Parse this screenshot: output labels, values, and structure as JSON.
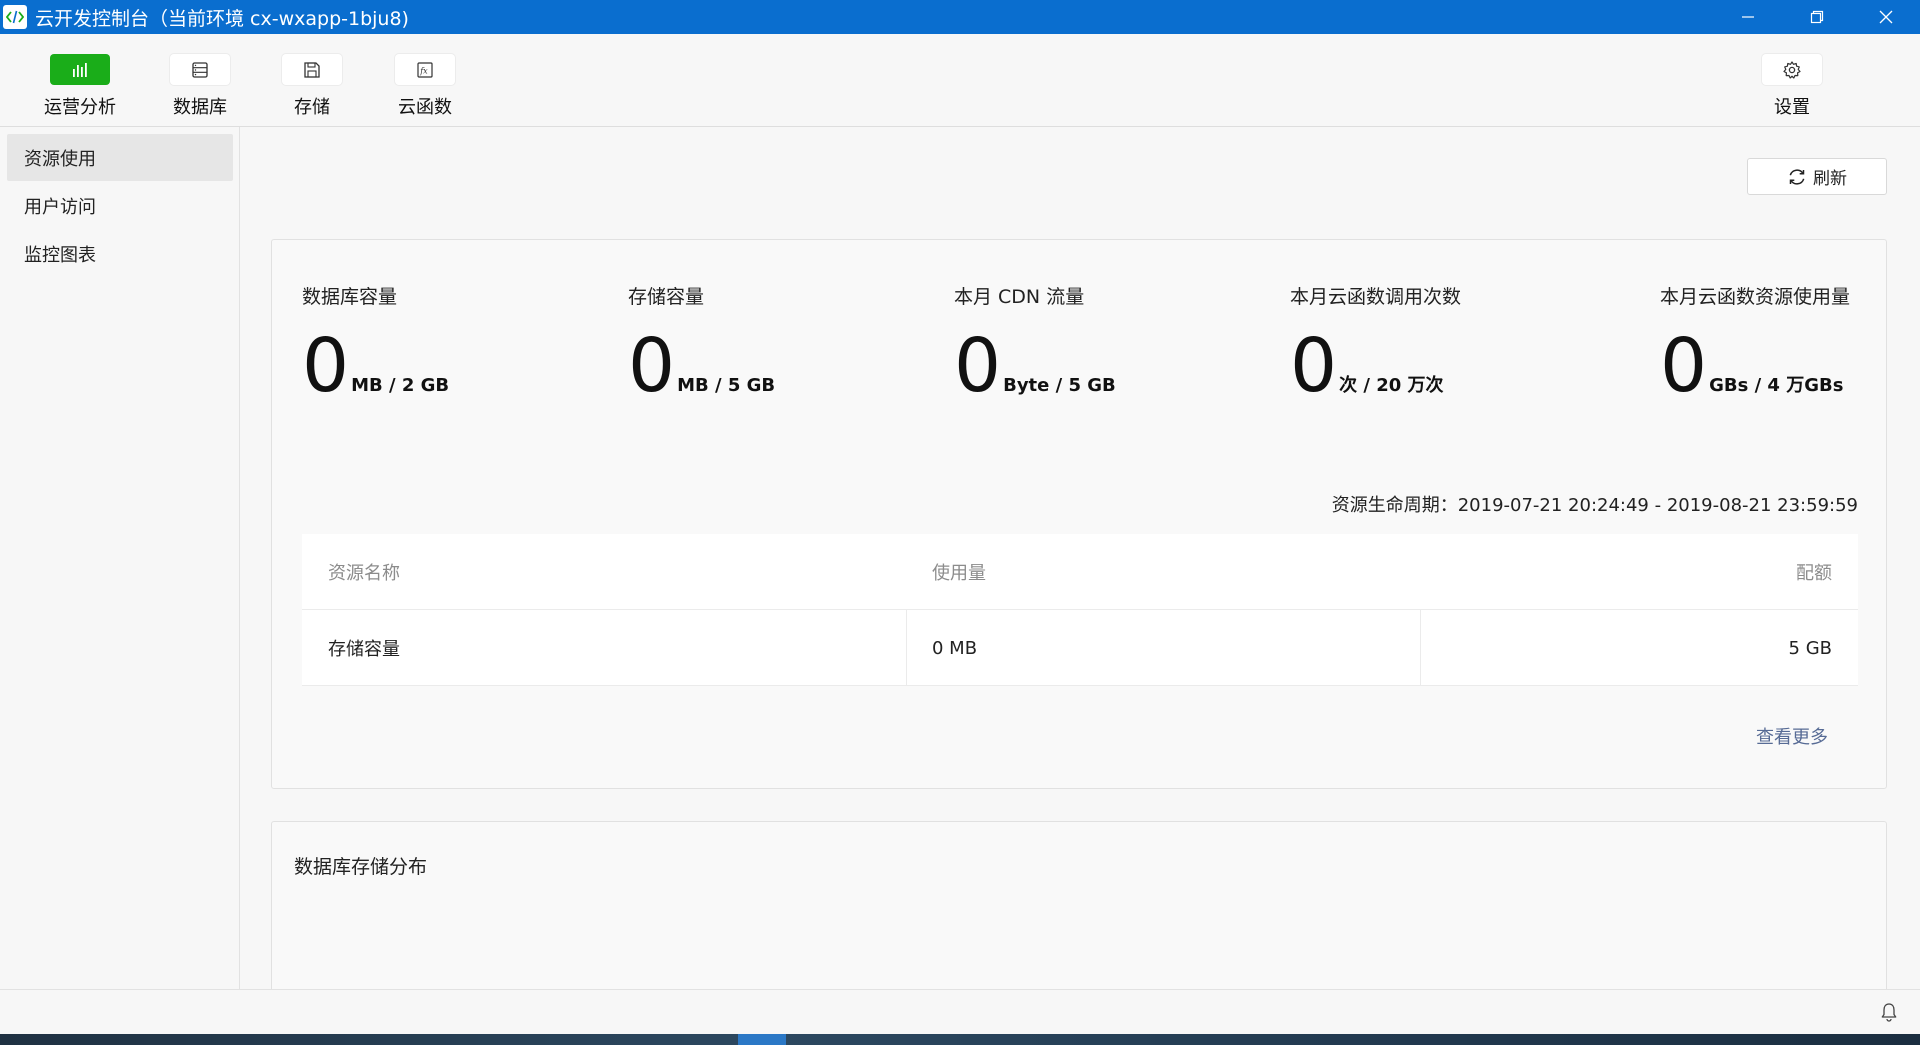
{
  "window": {
    "title": "云开发控制台（当前环境 cx-wxapp-1bju8)"
  },
  "toolbar": {
    "tools": [
      {
        "label": "运营分析",
        "icon": "bar-chart-icon",
        "active": true
      },
      {
        "label": "数据库",
        "icon": "database-icon",
        "active": false
      },
      {
        "label": "存储",
        "icon": "save-icon",
        "active": false
      },
      {
        "label": "云函数",
        "icon": "function-icon",
        "active": false
      }
    ],
    "settings_label": "设置"
  },
  "sidebar": {
    "items": [
      {
        "label": "资源使用",
        "active": true
      },
      {
        "label": "用户访问",
        "active": false
      },
      {
        "label": "监控图表",
        "active": false
      }
    ]
  },
  "main": {
    "refresh_label": "刷新",
    "metrics": [
      {
        "label": "数据库容量",
        "value": "0",
        "unit": "MB / 2 GB"
      },
      {
        "label": "存储容量",
        "value": "0",
        "unit": "MB / 5 GB"
      },
      {
        "label": "本月 CDN 流量",
        "value": "0",
        "unit": "Byte / 5 GB"
      },
      {
        "label": "本月云函数调用次数",
        "value": "0",
        "unit": "次 / 20 万次"
      },
      {
        "label": "本月云函数资源使用量",
        "value": "0",
        "unit": "GBs / 4 万GBs"
      }
    ],
    "lifecycle": "资源生命周期：2019-07-21 20:24:49 - 2019-08-21 23:59:59",
    "table": {
      "headers": [
        "资源名称",
        "使用量",
        "配额"
      ],
      "rows": [
        [
          "存储容量",
          "0 MB",
          "5 GB"
        ]
      ]
    },
    "more_label": "查看更多",
    "db_card_title": "数据库存储分布"
  },
  "colors": {
    "titlebar": "#0a6ecf",
    "accent": "#1aad19",
    "link": "#576b95"
  }
}
